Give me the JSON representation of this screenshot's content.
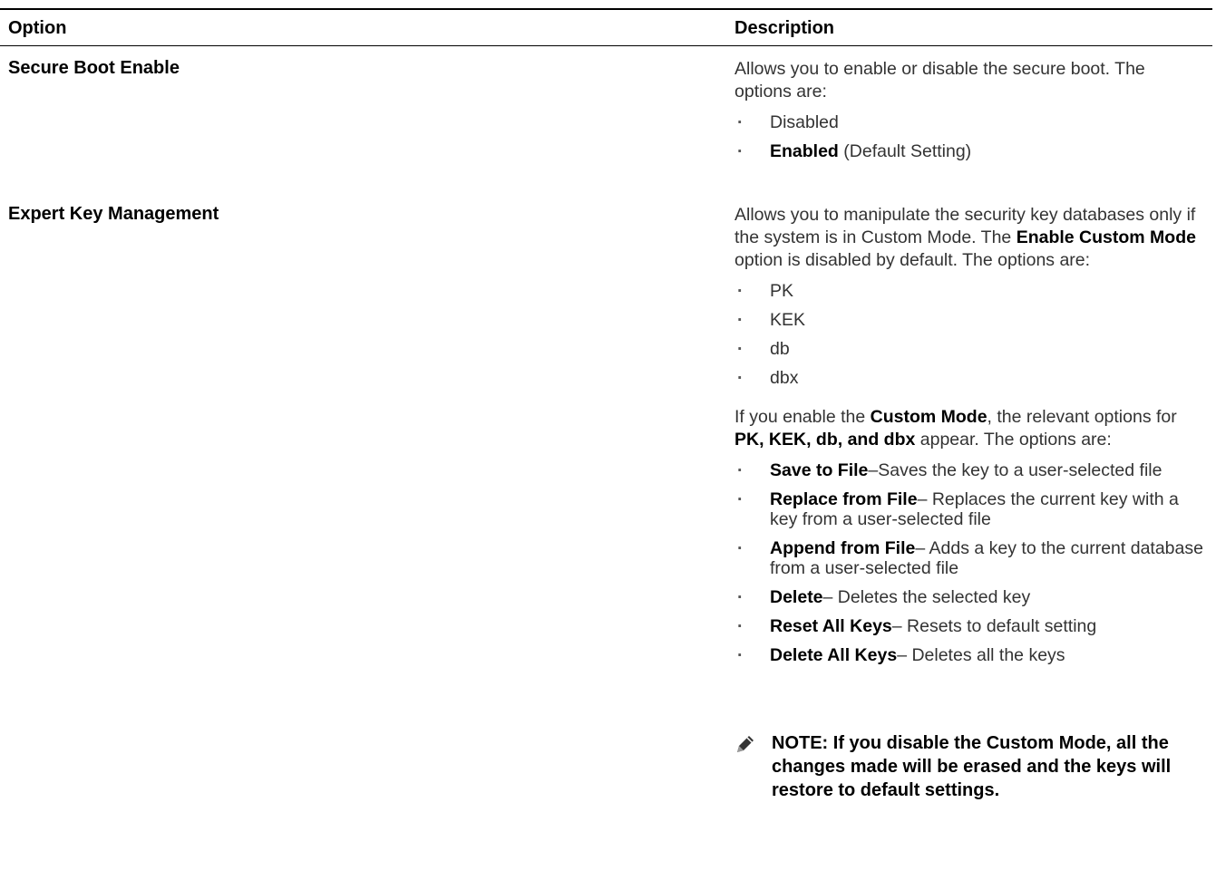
{
  "table": {
    "headers": {
      "option": "Option",
      "description": "Description"
    },
    "rows": [
      {
        "option": "Secure Boot Enable",
        "intro": [
          "Allows you to enable or disable the secure boot. The options are:"
        ],
        "items": [
          {
            "bold": "",
            "text": "Disabled"
          },
          {
            "bold": "Enabled",
            "text": " (Default Setting)"
          }
        ]
      },
      {
        "option": "Expert Key Management",
        "intro": [
          "Allows you to manipulate the security key databases only if the system is in Custom Mode. The ",
          "Enable Custom Mode",
          " option is disabled by default. The options are:"
        ],
        "items": [
          {
            "bold": "",
            "text": "PK"
          },
          {
            "bold": "",
            "text": "KEK"
          },
          {
            "bold": "",
            "text": "db"
          },
          {
            "bold": "",
            "text": "dbx"
          }
        ],
        "para2": [
          "If you enable the ",
          "Custom Mode",
          ", the relevant options for ",
          "PK, KEK, db, and dbx",
          " appear. The options are:"
        ],
        "items2": [
          {
            "bold": "Save to File",
            "text": "–Saves the key to a user-selected file"
          },
          {
            "bold": "Replace from File",
            "text": "– Replaces the current key with a key from a user-selected file"
          },
          {
            "bold": "Append from File",
            "text": "– Adds a key to the current database from a user-selected file"
          },
          {
            "bold": "Delete",
            "text": "– Deletes the selected key"
          },
          {
            "bold": "Reset All Keys",
            "text": "– Resets to default setting"
          },
          {
            "bold": "Delete All Keys",
            "text": "– Deletes all the keys"
          }
        ],
        "note": "NOTE: If you disable the Custom Mode, all the changes made will be erased and the keys will restore to default settings."
      }
    ]
  },
  "icons": {
    "note": "pencil-note-icon"
  }
}
